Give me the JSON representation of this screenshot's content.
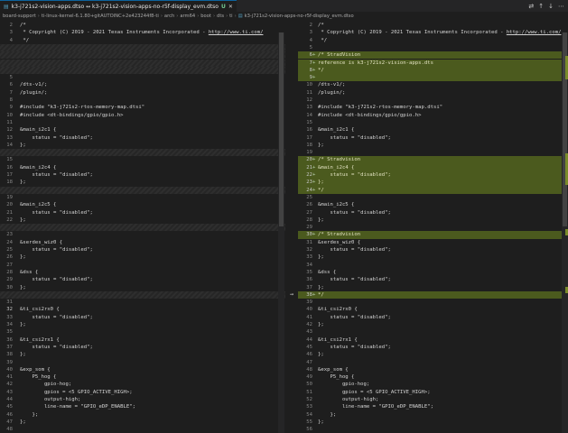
{
  "tab": {
    "title": "k3-j721s2-vision-apps.dtso ↔ k3-j721s2-vision-apps-no-r5f-display_evm.dtso",
    "modified_badge": "U"
  },
  "breadcrumb": [
    "board-support",
    "ti-linux-kernel-6.1.80+gitAUTOINC+2e423244f8-ti",
    "arch",
    "arm64",
    "boot",
    "dts",
    "ti",
    "k3-j721s2-vision-apps-no-r5f-display_evm.dtso"
  ],
  "left": [
    {
      "n": "2",
      "t": "/*",
      "s": "n"
    },
    {
      "n": "3",
      "t": " * Copyright (C) 2019 - 2021 Texas Instruments Incorporated - ",
      "u": "http://www.ti.com/",
      "s": "n"
    },
    {
      "n": "4",
      "t": " */",
      "s": "n"
    },
    {
      "n": "",
      "t": "",
      "s": "e"
    },
    {
      "n": "",
      "t": "",
      "s": "e"
    },
    {
      "n": "",
      "t": "",
      "s": "e"
    },
    {
      "n": "",
      "t": "",
      "s": "e"
    },
    {
      "n": "5",
      "t": "",
      "s": "n"
    },
    {
      "n": "6",
      "t": "/dts-v1/;",
      "s": "n"
    },
    {
      "n": "7",
      "t": "/plugin/;",
      "s": "n"
    },
    {
      "n": "8",
      "t": "",
      "s": "n"
    },
    {
      "n": "9",
      "t": "#include \"k3-j721s2-rtos-memory-map.dtsi\"",
      "s": "n"
    },
    {
      "n": "10",
      "t": "#include <dt-bindings/gpio/gpio.h>",
      "s": "n"
    },
    {
      "n": "11",
      "t": "",
      "s": "n"
    },
    {
      "n": "12",
      "t": "&main_i2c1 {",
      "s": "n"
    },
    {
      "n": "13",
      "t": "    status = \"disabled\";",
      "s": "n"
    },
    {
      "n": "14",
      "t": "};",
      "s": "n"
    },
    {
      "n": "",
      "t": "",
      "s": "e"
    },
    {
      "n": "15",
      "t": "",
      "s": "n"
    },
    {
      "n": "16",
      "t": "&main_i2c4 {",
      "s": "n"
    },
    {
      "n": "17",
      "t": "    status = \"disabled\";",
      "s": "n"
    },
    {
      "n": "18",
      "t": "};",
      "s": "n"
    },
    {
      "n": "",
      "t": "",
      "s": "e"
    },
    {
      "n": "19",
      "t": "",
      "s": "n"
    },
    {
      "n": "20",
      "t": "&main_i2c5 {",
      "s": "n"
    },
    {
      "n": "21",
      "t": "    status = \"disabled\";",
      "s": "n"
    },
    {
      "n": "22",
      "t": "};",
      "s": "n"
    },
    {
      "n": "",
      "t": "",
      "s": "e"
    },
    {
      "n": "23",
      "t": "",
      "s": "n"
    },
    {
      "n": "24",
      "t": "&serdes_wiz0 {",
      "s": "n"
    },
    {
      "n": "25",
      "t": "    status = \"disabled\";",
      "s": "n"
    },
    {
      "n": "26",
      "t": "};",
      "s": "n"
    },
    {
      "n": "27",
      "t": "",
      "s": "n"
    },
    {
      "n": "28",
      "t": "&dss {",
      "s": "n"
    },
    {
      "n": "29",
      "t": "    status = \"disabled\";",
      "s": "n"
    },
    {
      "n": "30",
      "t": "};",
      "s": "n"
    },
    {
      "n": "",
      "t": "",
      "s": "e"
    },
    {
      "n": "31",
      "t": "",
      "s": "n"
    },
    {
      "n": "32",
      "t": "&ti_csi2rx0 {",
      "s": "a"
    },
    {
      "n": "33",
      "t": "    status = \"disabled\";",
      "s": "n"
    },
    {
      "n": "34",
      "t": "};",
      "s": "n"
    },
    {
      "n": "35",
      "t": "",
      "s": "n"
    },
    {
      "n": "36",
      "t": "&ti_csi2rx1 {",
      "s": "n"
    },
    {
      "n": "37",
      "t": "    status = \"disabled\";",
      "s": "n"
    },
    {
      "n": "38",
      "t": "};",
      "s": "n"
    },
    {
      "n": "39",
      "t": "",
      "s": "n"
    },
    {
      "n": "40",
      "t": "&exp_som {",
      "s": "n"
    },
    {
      "n": "41",
      "t": "    P5_hog {",
      "s": "n"
    },
    {
      "n": "42",
      "t": "        gpio-hog;",
      "s": "n"
    },
    {
      "n": "43",
      "t": "        gpios = <5 GPIO_ACTIVE_HIGH>;",
      "s": "n"
    },
    {
      "n": "44",
      "t": "        output-high;",
      "s": "n"
    },
    {
      "n": "45",
      "t": "        line-name = \"GPIO_eDP_ENABLE\";",
      "s": "n"
    },
    {
      "n": "46",
      "t": "    };",
      "s": "n"
    },
    {
      "n": "47",
      "t": "};",
      "s": "n"
    },
    {
      "n": "48",
      "t": "",
      "s": "n"
    }
  ],
  "right": [
    {
      "n": "2",
      "t": "/*",
      "s": "n"
    },
    {
      "n": "3",
      "t": " * Copyright (C) 2019 - 2021 Texas Instruments Incorporated - ",
      "u": "http://www.ti.com/",
      "s": "n"
    },
    {
      "n": "4",
      "t": " */",
      "s": "n"
    },
    {
      "n": "5",
      "t": "",
      "s": "n"
    },
    {
      "n": "6",
      "t": "/* StradVision",
      "s": "a",
      "m": "+"
    },
    {
      "n": "7",
      "t": "reference is k3-j721s2-vision-apps.dts",
      "s": "a",
      "m": "+"
    },
    {
      "n": "8",
      "t": "*/",
      "s": "a",
      "m": "+"
    },
    {
      "n": "9",
      "t": "",
      "s": "a",
      "m": "+"
    },
    {
      "n": "10",
      "t": "/dts-v1/;",
      "s": "n"
    },
    {
      "n": "11",
      "t": "/plugin/;",
      "s": "n"
    },
    {
      "n": "12",
      "t": "",
      "s": "n"
    },
    {
      "n": "13",
      "t": "#include \"k3-j721s2-rtos-memory-map.dtsi\"",
      "s": "n"
    },
    {
      "n": "14",
      "t": "#include <dt-bindings/gpio/gpio.h>",
      "s": "n"
    },
    {
      "n": "15",
      "t": "",
      "s": "n"
    },
    {
      "n": "16",
      "t": "&main_i2c1 {",
      "s": "n"
    },
    {
      "n": "17",
      "t": "    status = \"disabled\";",
      "s": "n"
    },
    {
      "n": "18",
      "t": "};",
      "s": "n"
    },
    {
      "n": "19",
      "t": "",
      "s": "n"
    },
    {
      "n": "20",
      "t": "/* Stradvision",
      "s": "a",
      "m": "+"
    },
    {
      "n": "21",
      "t": "&main_i2c4 {",
      "s": "a",
      "m": "+"
    },
    {
      "n": "22",
      "t": "    status = \"disabled\";",
      "s": "a",
      "m": "+"
    },
    {
      "n": "23",
      "t": "};",
      "s": "a",
      "m": "+"
    },
    {
      "n": "24",
      "t": "*/",
      "s": "a",
      "m": "+"
    },
    {
      "n": "25",
      "t": "",
      "s": "n"
    },
    {
      "n": "26",
      "t": "&main_i2c5 {",
      "s": "n"
    },
    {
      "n": "27",
      "t": "    status = \"disabled\";",
      "s": "n"
    },
    {
      "n": "28",
      "t": "};",
      "s": "n"
    },
    {
      "n": "29",
      "t": "",
      "s": "n"
    },
    {
      "n": "30",
      "t": "/* Stradvision",
      "s": "a",
      "m": "+"
    },
    {
      "n": "31",
      "t": "&serdes_wiz0 {",
      "s": "n"
    },
    {
      "n": "32",
      "t": "    status = \"disabled\";",
      "s": "n"
    },
    {
      "n": "33",
      "t": "};",
      "s": "n"
    },
    {
      "n": "34",
      "t": "",
      "s": "n"
    },
    {
      "n": "35",
      "t": "&dss {",
      "s": "n"
    },
    {
      "n": "36",
      "t": "    status = \"disabled\";",
      "s": "n"
    },
    {
      "n": "37",
      "t": "};",
      "s": "n"
    },
    {
      "n": "38",
      "t": "*/",
      "s": "a",
      "m": "+"
    },
    {
      "n": "39",
      "t": "",
      "s": "n"
    },
    {
      "n": "40",
      "t": "&ti_csi2rx0 {",
      "s": "n"
    },
    {
      "n": "41",
      "t": "    status = \"disabled\";",
      "s": "n"
    },
    {
      "n": "42",
      "t": "};",
      "s": "n"
    },
    {
      "n": "43",
      "t": "",
      "s": "n"
    },
    {
      "n": "44",
      "t": "&ti_csi2rx1 {",
      "s": "n"
    },
    {
      "n": "45",
      "t": "    status = \"disabled\";",
      "s": "n"
    },
    {
      "n": "46",
      "t": "};",
      "s": "n"
    },
    {
      "n": "47",
      "t": "",
      "s": "n"
    },
    {
      "n": "48",
      "t": "&exp_som {",
      "s": "n"
    },
    {
      "n": "49",
      "t": "    P5_hog {",
      "s": "n"
    },
    {
      "n": "50",
      "t": "        gpio-hog;",
      "s": "n"
    },
    {
      "n": "51",
      "t": "        gpios = <5 GPIO_ACTIVE_HIGH>;",
      "s": "n"
    },
    {
      "n": "52",
      "t": "        output-high;",
      "s": "n"
    },
    {
      "n": "53",
      "t": "        line-name = \"GPIO_eDP_ENABLE\";",
      "s": "n"
    },
    {
      "n": "54",
      "t": "    };",
      "s": "n"
    },
    {
      "n": "55",
      "t": "};",
      "s": "n"
    },
    {
      "n": "56",
      "t": "",
      "s": "n"
    }
  ],
  "icons": {
    "file": "dts-file-icon",
    "tab_actions": [
      "source-control-icon",
      "arrow-up-icon",
      "arrow-down-icon",
      "more-icon"
    ],
    "revert": "arrow-right-icon"
  },
  "colors": {
    "added": "#4b5a1e",
    "accent": "#0e639c"
  }
}
